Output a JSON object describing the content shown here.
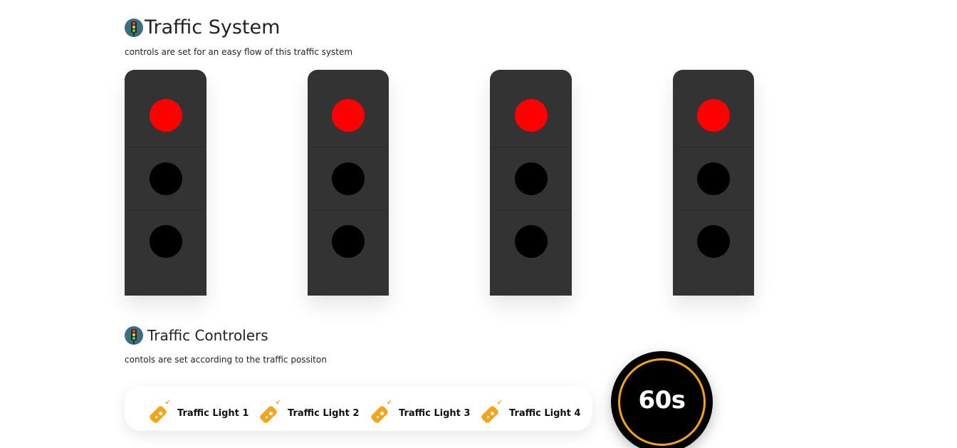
{
  "header": {
    "title": "Traffic System",
    "subtitle": "controls are set for an easy flow of this traffic system",
    "icon": "traffic-light-icon"
  },
  "traffic_lights": [
    {
      "id": 1,
      "active": "red"
    },
    {
      "id": 2,
      "active": "red"
    },
    {
      "id": 3,
      "active": "red"
    },
    {
      "id": 4,
      "active": "red"
    }
  ],
  "controllers": {
    "title": "Traffic Controlers",
    "subtitle": "contols are set according to the traffic possiton",
    "icon": "traffic-light-icon",
    "buttons": [
      {
        "label": "Traffic Light 1",
        "icon": "remote-control-icon"
      },
      {
        "label": "Traffic Light 2",
        "icon": "remote-control-icon"
      },
      {
        "label": "Traffic Light 3",
        "icon": "remote-control-icon"
      },
      {
        "label": "Traffic Light 4",
        "icon": "remote-control-icon"
      }
    ]
  },
  "timer": {
    "value": "60s"
  },
  "colors": {
    "light_housing": "#333333",
    "red_lamp": "#ff0000",
    "off_lamp": "#000000",
    "accent": "#f2a51a",
    "timer_bg": "#000000"
  }
}
